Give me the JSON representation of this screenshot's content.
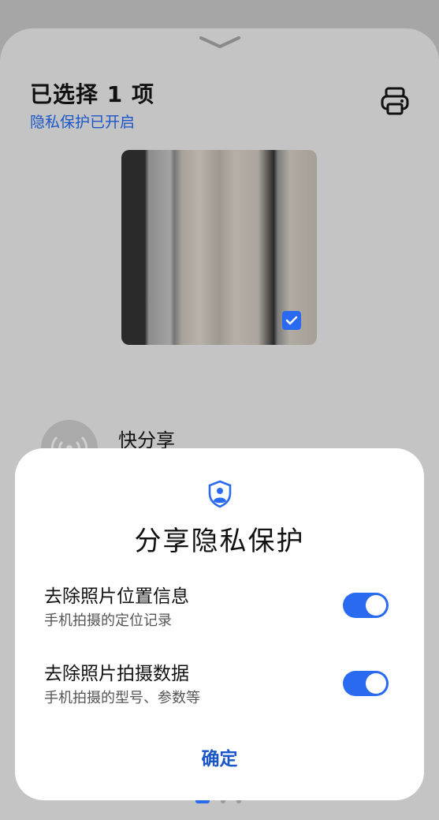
{
  "share_sheet": {
    "title": "已选择 1 项",
    "privacy_status": "隐私保护已开启",
    "quick_share_label": "快分享"
  },
  "privacy_dialog": {
    "title": "分享隐私保护",
    "options": [
      {
        "title": "去除照片位置信息",
        "subtitle": "手机拍摄的定位记录",
        "enabled": true
      },
      {
        "title": "去除照片拍摄数据",
        "subtitle": "手机拍摄的型号、参数等",
        "enabled": true
      }
    ],
    "confirm_label": "确定"
  },
  "colors": {
    "accent": "#2a6af0",
    "link": "#1a56c8",
    "overlay": "#c4c4c4"
  },
  "icons": [
    "chevron-down-icon",
    "printer-icon",
    "checkbox-checked-icon",
    "wireless-share-icon",
    "privacy-shield-icon"
  ]
}
